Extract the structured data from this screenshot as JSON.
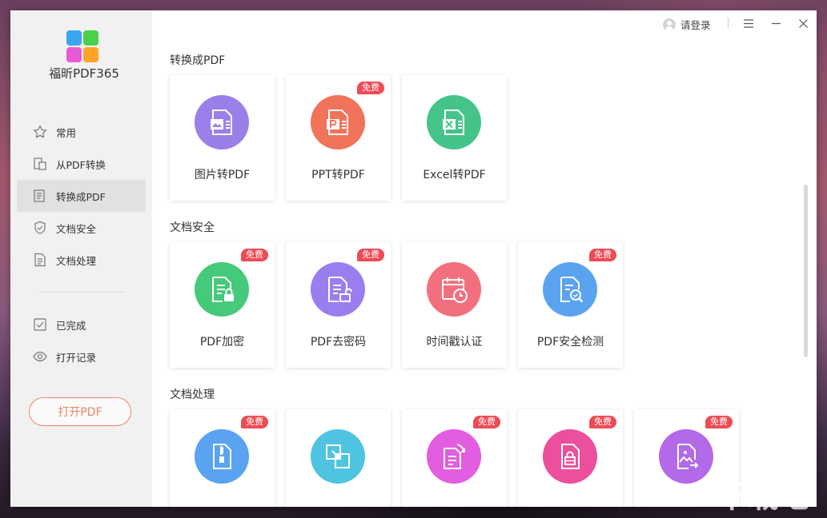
{
  "app": {
    "name": "福昕PDF365"
  },
  "titlebar": {
    "login_label": "请登录"
  },
  "sidebar": {
    "items": [
      {
        "label": "常用",
        "icon": "star-icon"
      },
      {
        "label": "从PDF转换",
        "icon": "convert-from-pdf-icon"
      },
      {
        "label": "转换成PDF",
        "icon": "convert-to-pdf-icon",
        "active": true
      },
      {
        "label": "文档安全",
        "icon": "shield-icon"
      },
      {
        "label": "文档处理",
        "icon": "document-icon"
      },
      {
        "label": "已完成",
        "icon": "check-square-icon"
      },
      {
        "label": "打开记录",
        "icon": "eye-icon"
      }
    ],
    "open_button": "打开PDF"
  },
  "badge_text": "免费",
  "sections": [
    {
      "title": "转换成PDF",
      "cards": [
        {
          "label": "图片转PDF",
          "icon": "image-to-pdf-icon",
          "color": "#9b7fe8",
          "free": false
        },
        {
          "label": "PPT转PDF",
          "icon": "ppt-to-pdf-icon",
          "color": "#f0735a",
          "free": true
        },
        {
          "label": "Excel转PDF",
          "icon": "excel-to-pdf-icon",
          "color": "#45c489",
          "free": false
        }
      ]
    },
    {
      "title": "文档安全",
      "cards": [
        {
          "label": "PDF加密",
          "icon": "pdf-encrypt-icon",
          "color": "#45c97a",
          "free": true
        },
        {
          "label": "PDF去密码",
          "icon": "pdf-remove-password-icon",
          "color": "#9a7ef0",
          "free": true
        },
        {
          "label": "时间戳认证",
          "icon": "timestamp-icon",
          "color": "#f2707e",
          "free": false
        },
        {
          "label": "PDF安全检测",
          "icon": "pdf-security-check-icon",
          "color": "#5aa3f0",
          "free": true
        }
      ]
    },
    {
      "title": "文档处理",
      "cards": [
        {
          "label": "",
          "icon": "zip-compress-icon",
          "color": "#5aa3f0",
          "free": true
        },
        {
          "label": "",
          "icon": "resize-icon",
          "color": "#4fc4e0",
          "free": false
        },
        {
          "label": "",
          "icon": "rotate-page-icon",
          "color": "#e35de0",
          "free": true
        },
        {
          "label": "",
          "icon": "lock-page-icon",
          "color": "#ec4f9c",
          "free": true
        },
        {
          "label": "",
          "icon": "image-export-icon",
          "color": "#b26ae8",
          "free": true
        }
      ]
    }
  ],
  "colors": {
    "accent": "#ea8565",
    "badge": "#ee4b55"
  },
  "watermark": "下载吧"
}
